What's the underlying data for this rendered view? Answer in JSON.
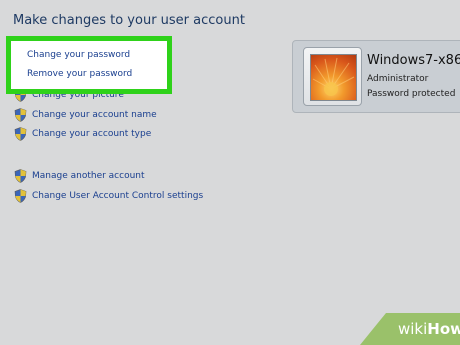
{
  "page": {
    "title": "Make changes to your user account"
  },
  "highlighted_tasks": [
    {
      "label": "Change your password"
    },
    {
      "label": "Remove your password"
    }
  ],
  "tasks": [
    {
      "label": "Change your picture",
      "icon": "none"
    },
    {
      "label": "Change your account name",
      "icon": "uac-shield-icon"
    },
    {
      "label": "Change your account type",
      "icon": "uac-shield-icon"
    },
    {
      "label": "Manage another account",
      "icon": "uac-shield-icon"
    },
    {
      "label": "Change User Account Control settings",
      "icon": "uac-shield-icon"
    }
  ],
  "account": {
    "name": "Windows7-x86",
    "role": "Administrator",
    "status": "Password protected"
  },
  "watermark": {
    "wiki": "wiki",
    "how": "How"
  },
  "colors": {
    "background": "#d8d9da",
    "link": "#1a3f8f",
    "title": "#1e3a63",
    "highlight_border": "#2fd21a",
    "watermark": "#9ac16a"
  }
}
